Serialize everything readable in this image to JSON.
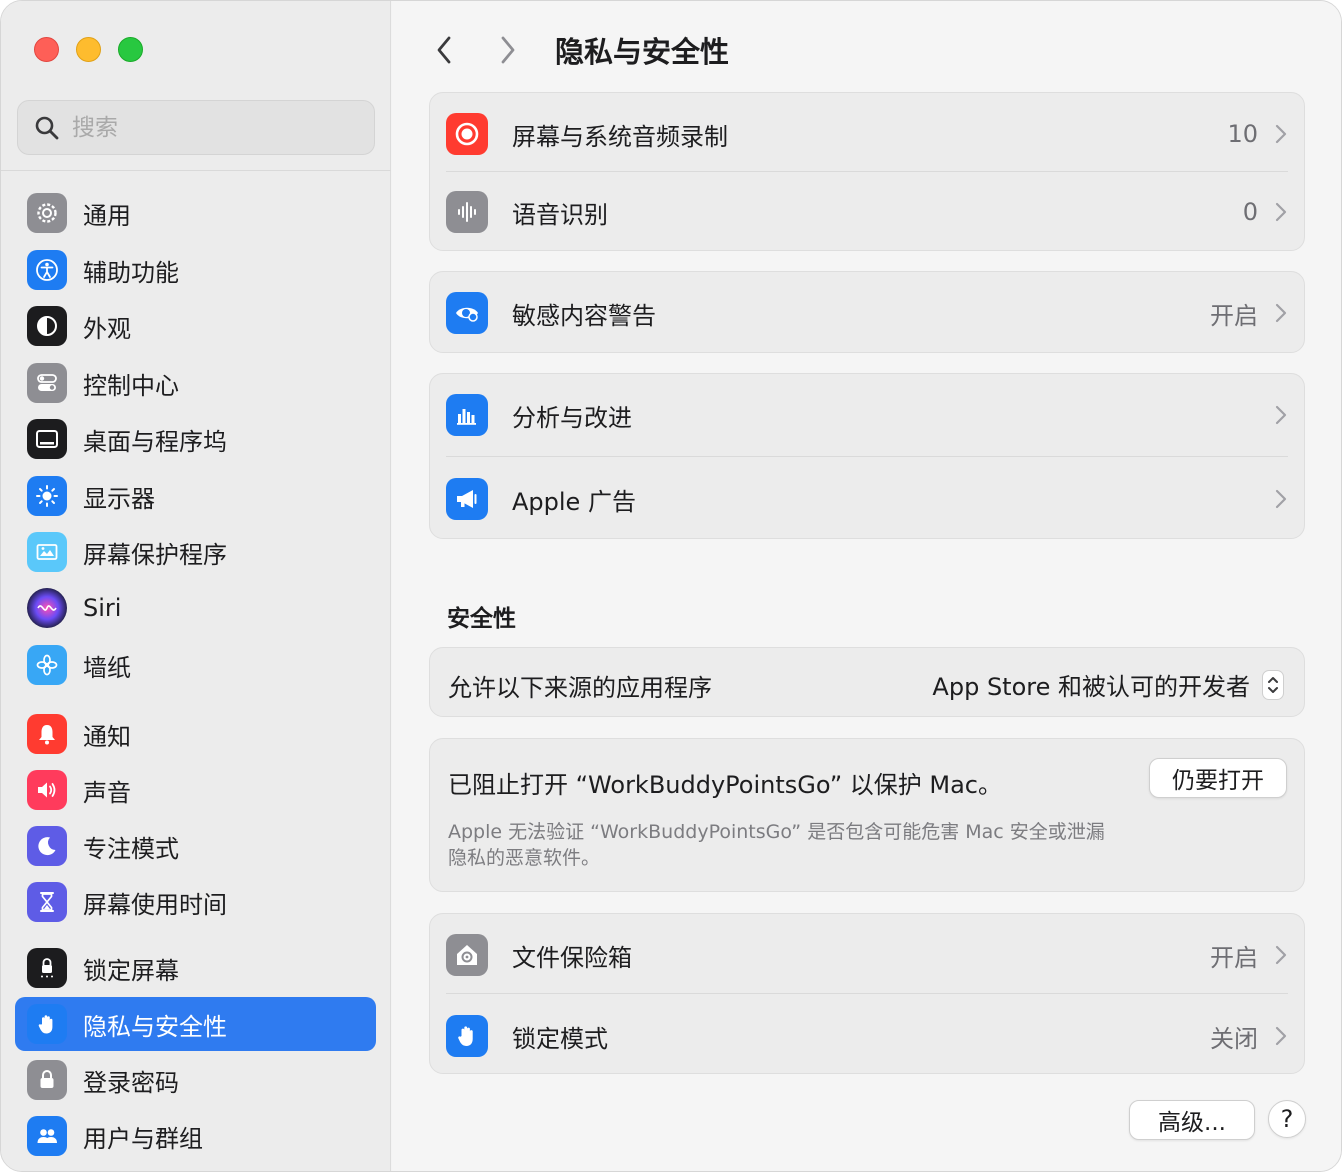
{
  "search": {
    "placeholder": "搜索"
  },
  "sidebar": {
    "items": [
      {
        "label": "通用",
        "icon": "gear-icon",
        "color": "#8e8e93"
      },
      {
        "label": "辅助功能",
        "icon": "accessibility-icon",
        "color": "#1e7cf2"
      },
      {
        "label": "外观",
        "icon": "appearance-icon",
        "color": "#1c1c1e"
      },
      {
        "label": "控制中心",
        "icon": "control-center-icon",
        "color": "#8e8e93"
      },
      {
        "label": "桌面与程序坞",
        "icon": "desktop-dock-icon",
        "color": "#1c1c1e"
      },
      {
        "label": "显示器",
        "icon": "display-sun-icon",
        "color": "#1e7cf2"
      },
      {
        "label": "屏幕保护程序",
        "icon": "screensaver-icon",
        "color": "#5ac8fa"
      },
      {
        "label": "Siri",
        "icon": "siri-icon",
        "color": "#2b2b6a"
      },
      {
        "label": "墙纸",
        "icon": "wallpaper-flower-icon",
        "color": "#38a7f5"
      },
      {
        "label": "通知",
        "icon": "bell-icon",
        "color": "#ff3b30"
      },
      {
        "label": "声音",
        "icon": "speaker-icon",
        "color": "#ff3b5c"
      },
      {
        "label": "专注模式",
        "icon": "moon-icon",
        "color": "#5e5ce6"
      },
      {
        "label": "屏幕使用时间",
        "icon": "hourglass-icon",
        "color": "#5e5ce6"
      },
      {
        "label": "锁定屏幕",
        "icon": "lock-screen-icon",
        "color": "#1c1c1e"
      },
      {
        "label": "隐私与安全性",
        "icon": "hand-icon",
        "color": "#1e7cf2"
      },
      {
        "label": "登录密码",
        "icon": "padlock-icon",
        "color": "#8e8e93"
      },
      {
        "label": "用户与群组",
        "icon": "users-icon",
        "color": "#1e7cf2"
      }
    ]
  },
  "header": {
    "title": "隐私与安全性"
  },
  "privacy": {
    "screen_recording": {
      "label": "屏幕与系统音频录制",
      "value": "10"
    },
    "speech": {
      "label": "语音识别",
      "value": "0"
    },
    "sensitive": {
      "label": "敏感内容警告",
      "value": "开启"
    },
    "analytics": {
      "label": "分析与改进"
    },
    "ads": {
      "label": "Apple 广告"
    }
  },
  "security": {
    "title": "安全性",
    "allow_label": "允许以下来源的应用程序",
    "allow_value": "App Store 和被认可的开发者",
    "blocked_title": "已阻止打开 “WorkBuddyPointsGo” 以保护 Mac。",
    "blocked_desc_1": "Apple 无法验证 “WorkBuddyPointsGo” 是否包含可能危害 Mac 安全或泄漏",
    "blocked_desc_2": "隐私的恶意软件。",
    "open_anyway": "仍要打开",
    "filevault": {
      "label": "文件保险箱",
      "value": "开启"
    },
    "lockdown": {
      "label": "锁定模式",
      "value": "关闭"
    }
  },
  "footer": {
    "advanced": "高级...",
    "help": "?"
  },
  "colors": {
    "accent": "#2f7bf0",
    "red": "#ff3b30"
  }
}
